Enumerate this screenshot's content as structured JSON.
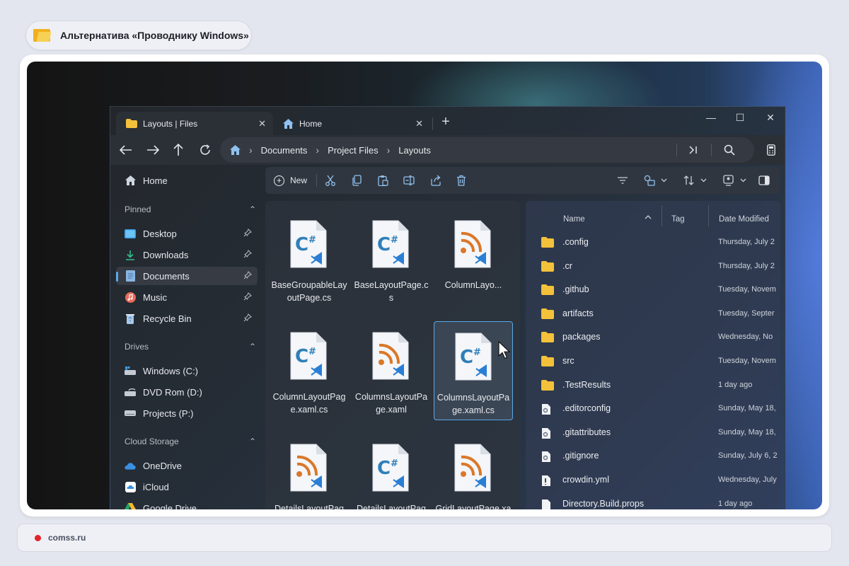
{
  "header": {
    "title": "Альтернатива «Проводнику Windows»"
  },
  "tabs": [
    {
      "label": "Layouts | Files",
      "close": "✕"
    },
    {
      "label": "Home",
      "close": "✕"
    }
  ],
  "tab_add": "+",
  "window_controls": {
    "minimize": "—",
    "maximize": "☐",
    "close": "✕"
  },
  "breadcrumb": {
    "sep": "›",
    "items": [
      "Documents",
      "Project Files",
      "Layouts"
    ]
  },
  "sidebar": {
    "home": "Home",
    "pinned_header": "Pinned",
    "pinned": [
      "Desktop",
      "Downloads",
      "Documents",
      "Music",
      "Recycle Bin"
    ],
    "drives_header": "Drives",
    "drives": [
      "Windows (C:)",
      "DVD Rom (D:)",
      "Projects (P:)"
    ],
    "cloud_header": "Cloud Storage",
    "cloud": [
      "OneDrive",
      "iCloud",
      "Google Drive"
    ],
    "collapse_glyph": "⌃"
  },
  "toolbar": {
    "new_label": "New"
  },
  "grid": [
    {
      "name": "BaseGroupableLayoutPage.cs",
      "kind": "csharp"
    },
    {
      "name": "BaseLayoutPage.cs",
      "kind": "csharp"
    },
    {
      "name": "ColumnLayo...",
      "kind": "rss"
    },
    {
      "name": "ColumnLayoutPage.xaml.cs",
      "kind": "csharp"
    },
    {
      "name": "ColumnsLayoutPage.xaml",
      "kind": "rss"
    },
    {
      "name": "ColumnsLayoutPage.xaml.cs",
      "kind": "csharp"
    },
    {
      "name": "DetailsLayoutPage.xaml",
      "kind": "rss"
    },
    {
      "name": "DetailsLayoutPage.xaml.cs",
      "kind": "csharp"
    },
    {
      "name": "GridLayoutPage.xaml",
      "kind": "rss"
    }
  ],
  "details": {
    "columns": {
      "name": "Name",
      "tag": "Tag",
      "date": "Date Modified"
    },
    "rows": [
      {
        "name": ".config",
        "date": "Thursday, July 2",
        "type": "folder"
      },
      {
        "name": ".cr",
        "date": "Thursday, July 2",
        "type": "folder"
      },
      {
        "name": ".github",
        "date": "Tuesday, Novem",
        "type": "folder"
      },
      {
        "name": "artifacts",
        "date": "Tuesday, Septer",
        "type": "folder"
      },
      {
        "name": "packages",
        "date": "Wednesday, No",
        "type": "folder"
      },
      {
        "name": "src",
        "date": "Tuesday, Novem",
        "type": "folder"
      },
      {
        "name": ".TestResults",
        "date": "1 day ago",
        "type": "folder"
      },
      {
        "name": ".editorconfig",
        "date": "Sunday, May 18,",
        "type": "config"
      },
      {
        "name": ".gitattributes",
        "date": "Sunday, May 18,",
        "type": "config"
      },
      {
        "name": ".gitignore",
        "date": "Sunday, July 6, 2",
        "type": "config"
      },
      {
        "name": "crowdin.yml",
        "date": "Wednesday, July",
        "type": "yml"
      },
      {
        "name": "Directory.Build.props",
        "date": "1 day ago",
        "type": "file"
      }
    ]
  },
  "footer": {
    "site": "comss.ru"
  },
  "colors": {
    "accent": "#5aa8f0",
    "folder": "#f3c13a",
    "csharp": "#2f7fb8",
    "rss": "#d9782a",
    "footer_dot": "#e0262a"
  }
}
